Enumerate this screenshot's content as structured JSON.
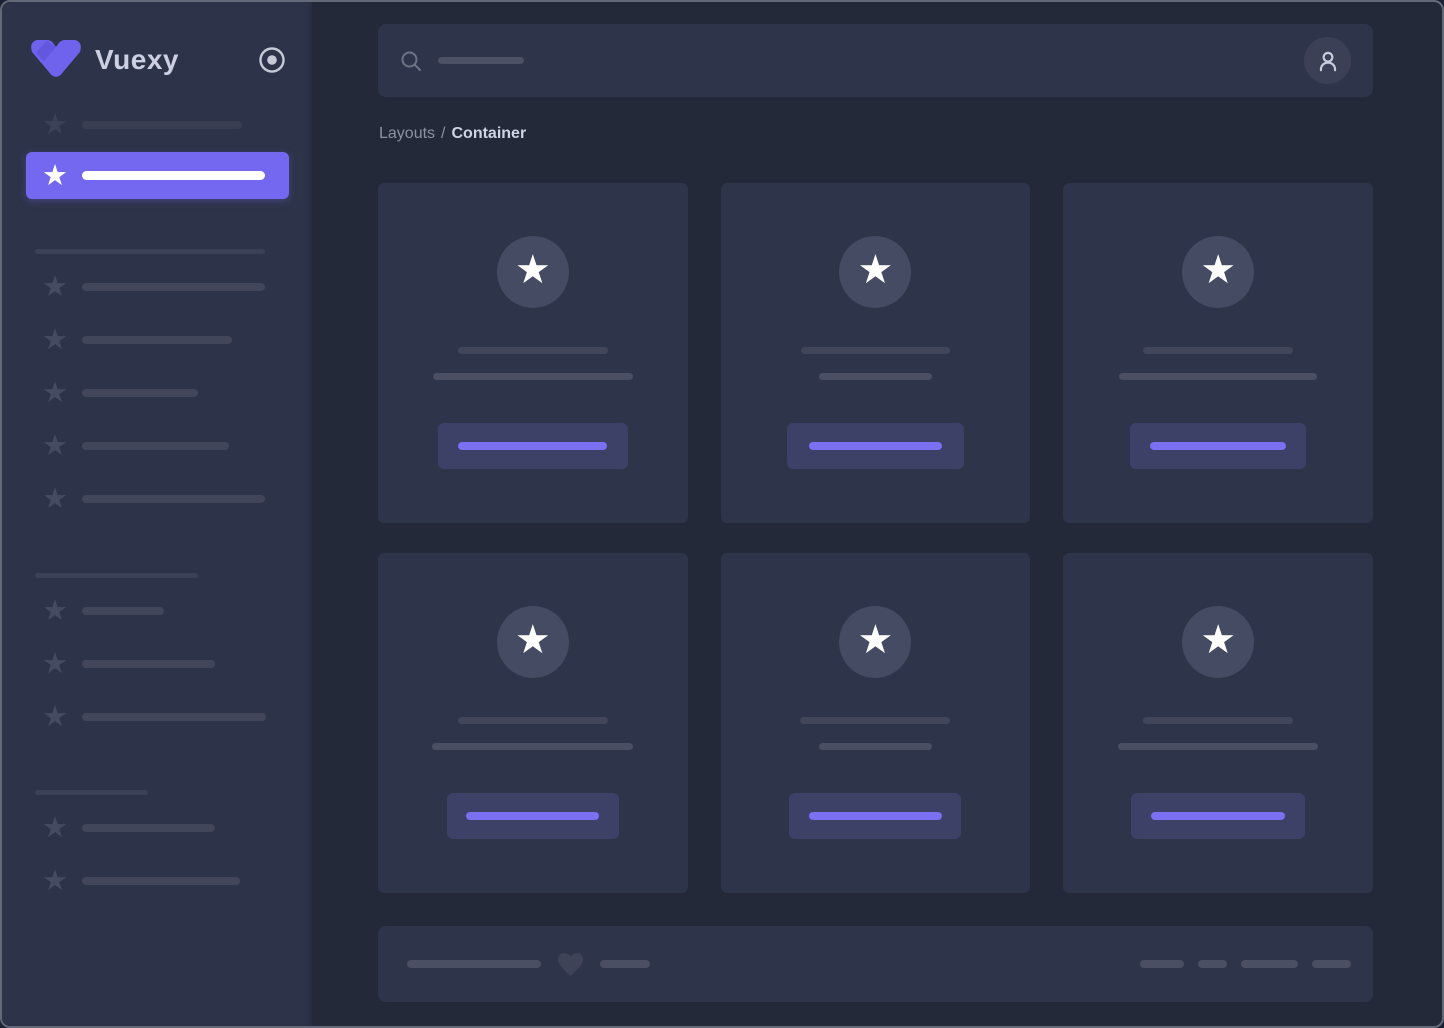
{
  "app": {
    "name": "Vuexy"
  },
  "glyphs": {
    "star": "★"
  },
  "colors": {
    "accent": "#7568f0",
    "page_bg": "#232939",
    "panel_bg": "#2e3449",
    "sidebar_bg": "#2d3348",
    "skeleton_dark": "#41465b",
    "skeleton_light": "#4a4f64",
    "button_bar": "#7b70f1"
  },
  "breadcrumb": {
    "section": "Layouts",
    "separator": "/",
    "page": "Container"
  },
  "header": {
    "search_ph": "width:86px"
  },
  "sidebar": {
    "rows": [
      {
        "type": "item-dim",
        "bar": "width:160px"
      },
      {
        "type": "item-active",
        "bar": "width:183px"
      },
      {
        "type": "heading",
        "bar": "width:230px"
      },
      {
        "type": "item",
        "bar": "width:183px"
      },
      {
        "type": "item",
        "bar": "width:150px"
      },
      {
        "type": "item",
        "bar": "width:116px"
      },
      {
        "type": "item",
        "bar": "width:147px"
      },
      {
        "type": "item",
        "bar": "width:183px"
      },
      {
        "type": "heading",
        "bar": "width:163px"
      },
      {
        "type": "item",
        "bar": "width:82px"
      },
      {
        "type": "item",
        "bar": "width:133px"
      },
      {
        "type": "item",
        "bar": "width:184px"
      },
      {
        "type": "heading",
        "bar": "width:113px"
      },
      {
        "type": "item",
        "bar": "width:133px"
      },
      {
        "type": "item",
        "bar": "width:158px"
      }
    ]
  },
  "cards": [
    {
      "line1": "width:150px",
      "line2": "width:200px",
      "button": "width:190px",
      "button_bar": "width:149px"
    },
    {
      "line1": "width:149px",
      "line2": "width:113px",
      "button": "width:177px",
      "button_bar": "width:133px"
    },
    {
      "line1": "width:150px",
      "line2": "width:198px",
      "button": "width:176px",
      "button_bar": "width:136px"
    },
    {
      "line1": "width:150px",
      "line2": "width:201px",
      "button": "width:172px",
      "button_bar": "width:133px"
    },
    {
      "line1": "width:150px",
      "line2": "width:113px",
      "button": "width:172px",
      "button_bar": "width:133px"
    },
    {
      "line1": "width:150px",
      "line2": "width:200px",
      "button": "width:174px",
      "button_bar": "width:134px"
    }
  ],
  "footer": {
    "left_bars": [
      "width:134px",
      "width:50px"
    ],
    "right_bars": [
      "width:44px",
      "width:29px",
      "width:57px",
      "width:39px"
    ]
  }
}
